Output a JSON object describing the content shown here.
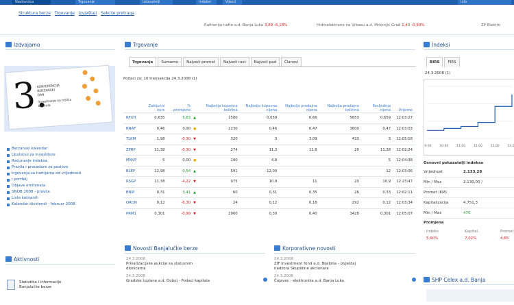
{
  "topnav": {
    "tabs": [
      "Naslovnica",
      "Trgovanje",
      "Izdavatelji",
      "Indeksi",
      "Vijesti",
      "Info"
    ]
  },
  "subnav": [
    "Struktura berze",
    "Trgovanje",
    "Izvještaji",
    "Sekcije pretraga"
  ],
  "ticker": [
    {
      "text": "Rafinerija nafte a.d. Banja Luka",
      "value": "3,89",
      "change": "-6,18%"
    },
    {
      "text": "Hidroelektrane na Vrbasu a.d. Mrkonjić Grad",
      "value": "1,40",
      "change": "-0,90%"
    },
    {
      "text": "ZP Elektro",
      "value": "",
      "change": ""
    }
  ],
  "left": {
    "title": "Izdvajamo",
    "ad": {
      "big": "3.",
      "lines": [
        "KONFERENCIJA",
        "BERZANSKI",
        "DAN",
        "Investiranje na tržištu kapitala"
      ]
    },
    "links": [
      "Berzanski kalendar",
      "Uputstvo za investitore",
      "Računanje indeksa",
      "Pravila i procedure za poslove ",
      "trgovanja sa hartijama od vrijednosti",
      "i portfelj",
      "Objave emitenata",
      "SNOB 2008 - pravila",
      "Lista kotiranih",
      "Kalendar dividendi - februar 2008"
    ],
    "title2": "Aktivnosti",
    "activity": [
      "Statistika i informacije",
      "Banjalučke berze"
    ]
  },
  "center": {
    "title": "Trgovanje",
    "tabs": [
      "Trgovanje",
      "Sumarno",
      "Najveći promet",
      "Najveći rast",
      "Najveći pad",
      "Članovi"
    ],
    "subtitle": "Podaci za: 10 transakcija 24.3.2008 (1)",
    "headers": [
      "",
      "Zaključni kurs",
      "% promjene",
      "",
      "Najbolja kupovna količina",
      "Najbolja kupovna cijena",
      "Najbolja prodajna cijena",
      "Najbolja prodajna količina",
      "Posljednja cijena",
      "Vrijeme"
    ],
    "rows": [
      {
        "sym": "RFUH",
        "kurs": "0,635",
        "pct": "5,83",
        "dir": "up",
        "bq": "1580",
        "bp": "0,659",
        "sp": "0,66",
        "sq": "5653",
        "last": "0,659",
        "time": "12:03:27"
      },
      {
        "sym": "RNAF",
        "kurs": "0,46",
        "pct": "0,00",
        "dir": "eq",
        "bq": "2230",
        "bp": "0,46",
        "sp": "0,47",
        "sq": "3600",
        "last": "0,47",
        "time": "12:03:03"
      },
      {
        "sym": "TLKM",
        "kurs": "1,98",
        "pct": "-0,30",
        "dir": "dn",
        "bq": "320",
        "bp": "3",
        "sp": "3,09",
        "sq": "433",
        "last": "3",
        "time": "12:05:18"
      },
      {
        "sym": "ZPRP",
        "kurs": "11,38",
        "pct": "-0,30",
        "dir": "dn",
        "bq": "274",
        "bp": "11,3",
        "sp": "11,8",
        "sq": "20",
        "last": "11,38",
        "time": "12:02:24"
      },
      {
        "sym": "MNVP",
        "kurs": "5",
        "pct": "0,00",
        "dir": "eq",
        "bq": "190",
        "bp": "4,8",
        "sp": "",
        "sq": "",
        "last": "5",
        "time": "12:04:38"
      },
      {
        "sym": "BLEP",
        "kurs": "12,98",
        "pct": "0,54",
        "dir": "up",
        "bq": "591",
        "bp": "12,00",
        "sp": "",
        "sq": "",
        "last": "12",
        "time": "12:03:06"
      },
      {
        "sym": "RSGP",
        "kurs": "11,38",
        "pct": "-4,22",
        "dir": "dn",
        "bq": "975",
        "bp": "10,9",
        "sp": "11",
        "sq": "20",
        "last": "10,9",
        "time": "12:23:47"
      },
      {
        "sym": "BNIP",
        "kurs": "0,31",
        "pct": "3,41",
        "dir": "up",
        "bq": "60",
        "bp": "0,31",
        "sp": "0,35",
        "sq": "26",
        "last": "0,33",
        "time": "12:02:11"
      },
      {
        "sym": "ORDN",
        "kurs": "0,12",
        "pct": "-6,30",
        "dir": "dn",
        "bq": "24",
        "bp": "0,12",
        "sp": "0,16",
        "sq": "292",
        "last": "0,12",
        "time": "12:03:34"
      },
      {
        "sym": "PRM1",
        "kurs": "0,301",
        "pct": "-0,99",
        "dir": "dn",
        "bq": "2960",
        "bp": "0,30",
        "sp": "0,40",
        "sq": "3428",
        "last": "0,301",
        "time": "12:05:07"
      }
    ],
    "news1_title": "Novosti Banjalučke berze",
    "news1": [
      {
        "date": "24.3.2008",
        "text": "Privatizacijske aukcije sa statusnim"
      },
      {
        "date": "",
        "text": "dionicama"
      },
      {
        "date": "24.3.2008",
        "text": "Gradske toplane a.d. Doboj - Podaci kapitala"
      }
    ],
    "news2_title": "Korporativne novosti",
    "news2": [
      {
        "date": "24.3.2008",
        "text": "ZIF Investment fond a.d. Bijeljina - izvještaj"
      },
      {
        "date": "",
        "text": "nadzora Skupštine akcionara"
      },
      {
        "date": "24.3.2008",
        "text": "Čajavec - elektronika a.d. Banja Luka"
      }
    ]
  },
  "right": {
    "title": "Indeksi",
    "tabs": [
      "BIRS",
      "FIRS"
    ],
    "chart_caption": "24.3.2008 (1)",
    "chart_data": {
      "type": "line",
      "x": [
        "09:00",
        "10:00",
        "11:00",
        "12:00",
        "13:00",
        "14:00"
      ],
      "series": [
        {
          "name": "BIRS",
          "values": [
            2100,
            2101,
            2102,
            2104,
            2112,
            2118
          ]
        }
      ]
    },
    "stats_title": "Osnovni pokazatelji indeksa",
    "stats": [
      {
        "label": "Vrijednost",
        "value": "2.133,28"
      },
      {
        "label": "Min / Max",
        "value": "2.130,00 /"
      },
      {
        "label": "Promet (KM)",
        "value": ""
      },
      {
        "label": "Kapitalizacija",
        "value": "4.751,3"
      },
      {
        "label": "Min / Max",
        "value": "470"
      }
    ],
    "promene_label": "Promjena",
    "changes": [
      {
        "label": "Indeks",
        "value": "5,60%"
      },
      {
        "label": "Kapital.",
        "value": "7,02%"
      },
      {
        "label": "Promet",
        "value": "4,65"
      }
    ],
    "box2_title": "SHP Celex a.d. Banja"
  }
}
